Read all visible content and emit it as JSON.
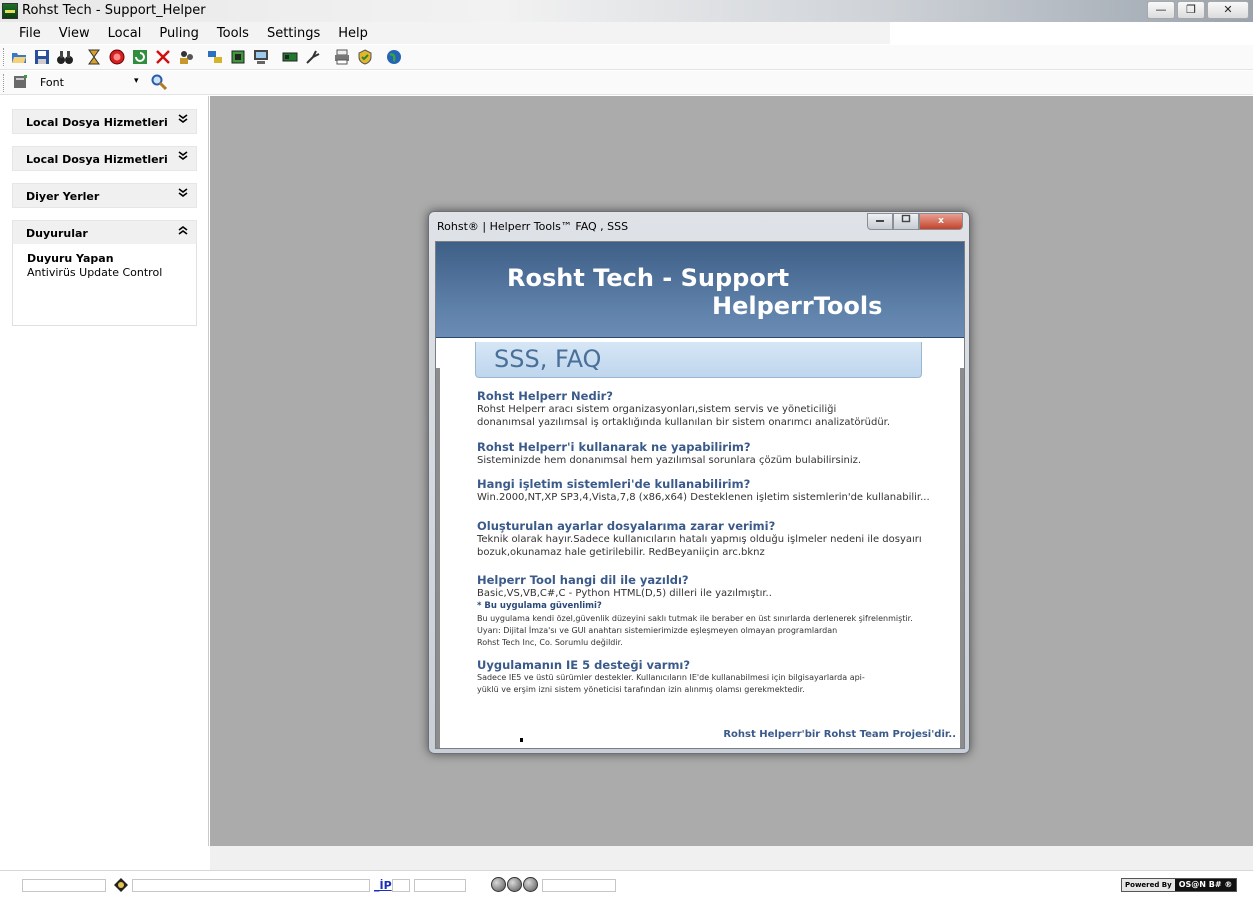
{
  "window": {
    "title": "Rohst Tech - Support_Helper",
    "minimize": "—",
    "maximize": "❐",
    "close": "✕"
  },
  "menu": [
    "File",
    "View",
    "Local",
    "Puling",
    "Tools",
    "Settings",
    "Help"
  ],
  "toolbar2": {
    "font_label": "Font",
    "dropdown_arrow": "▾"
  },
  "sidebar": {
    "sections": [
      {
        "title": "Local Dosya Hizmetleri",
        "chevron": "⌄"
      },
      {
        "title": "Local Dosya Hizmetleri",
        "chevron": "⌄"
      },
      {
        "title": "Diyer Yerler",
        "chevron": "⌄"
      },
      {
        "title": "Duyurular",
        "chevron": "⌃"
      }
    ],
    "announcement": {
      "title": "Duyuru Yapan",
      "text": "Antivirüs Update Control"
    }
  },
  "dialog": {
    "title": "Rohst® | Helperr Tools™  FAQ , SSS",
    "close_label": "x",
    "banner_line1": "Rosht Tech - Support",
    "banner_line2": "HelperrTools",
    "section_title": "SSS, FAQ",
    "faq": [
      {
        "q": "Rohst Helperr Nedir?",
        "a1": "Rohst Helperr aracı sistem organizasyonları,sistem servis ve yöneticiliği",
        "a2": "donanımsal yazılımsal iş ortaklığında kullanılan bir sistem onarımcı analizatörüdür."
      },
      {
        "q": "Rohst Helperr'i kullanarak ne yapabilirim?",
        "a1": "Sisteminizde hem donanımsal hem yazılımsal sorunlara çözüm bulabilirsiniz."
      },
      {
        "q": "Hangi işletim sistemleri'de kullanabilirim?",
        "a1": "Win.2000,NT,XP SP3,4,Vista,7,8 (x86,x64) Desteklenen işletim sistemlerin'de kullanabilir..."
      },
      {
        "q": "Oluşturulan ayarlar dosyalarıma zarar verimi?",
        "a1": "Teknik olarak hayır.Sadece kullanıcıların hatalı yapmış olduğu işlmeler nedeni ile dosyaırı",
        "a2": "bozuk,okunamaz hale getirilebilir.   RedBeyaniiçin arc.bknz"
      },
      {
        "q": "Helperr Tool hangi dil ile yazıldı?",
        "a1": "Basic,VS,VB,C#,C - Python HTML(D,5) dilleri ile yazılmıştır..",
        "note": "* Bu uygulama güvenlimi?",
        "s1": "Bu uygulama kendi özel,güvenlik düzeyini saklı tutmak ile beraber en üst sınırlarda derlenerek şifrelenmiştir.",
        "s2": "Uyarı: Dijital İmza'sı ve GUI anahtarı sistemierimizde eşleşmeyen  olmayan programlardan",
        "s3": "Rohst Tech Inc, Co. Sorumlu değildir."
      },
      {
        "q": "Uygulamanın IE 5 desteği varmı?",
        "s1": "Sadece IE5 ve üstü sürümler destekler. Kullanıcıların IE'de kullanabilmesi için bilgisayarlarda api-",
        "s2": "yüklü  ve erşim izni sistem yöneticisi tarafından izin alınmış olamsı gerekmektedir."
      }
    ],
    "footer": "Rohst Helperr'bir Rohst Team Projesi'dir.."
  },
  "statusbar": {
    "ip_label": "_İP",
    "powered_by": "Powered By",
    "brand": "OS@N B# ®"
  }
}
